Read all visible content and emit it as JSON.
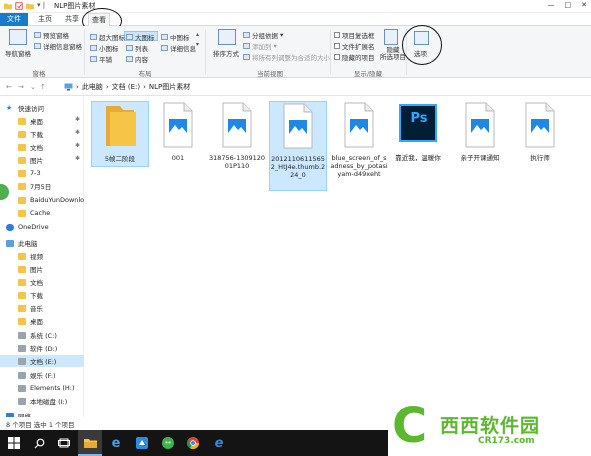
{
  "window": {
    "title": "NLP图片素材",
    "controls": [
      "—",
      "□",
      "✕"
    ]
  },
  "tabs": [
    {
      "label": "文件"
    },
    {
      "label": "主页"
    },
    {
      "label": "共享"
    },
    {
      "label": "查看"
    }
  ],
  "ribbon": {
    "panes": {
      "label": "窗格",
      "nav_pane": "导航窗格",
      "preview_pane": "预览窗格",
      "details_pane": "详细信息窗格"
    },
    "layout": {
      "label": "布局",
      "xl_icons": "超大图标",
      "large_icons": "大图标",
      "medium_icons": "中图标",
      "small_icons": "小图标",
      "list": "列表",
      "details": "详细信息",
      "tiles": "平铺",
      "content": "内容"
    },
    "current_view": {
      "label": "当前视图",
      "sort_by": "排序方式",
      "group_by": "分组依据",
      "add_columns": "添加列",
      "size_all_columns": "将所有列调整为合适的大小"
    },
    "show_hide": {
      "label": "显示/隐藏",
      "item_checkboxes": "项目复选框",
      "file_extensions": "文件扩展名",
      "hidden_items": "隐藏的项目",
      "hide_selected": "隐藏\n所选项目"
    },
    "options": "选项"
  },
  "address": {
    "crumbs": [
      "此电脑",
      "文档 (E:)",
      "NLP图片素材"
    ]
  },
  "nav_pane": {
    "items": [
      {
        "label": "快速访问",
        "icon": "star-icon",
        "indent": 0,
        "pinned": false
      },
      {
        "label": "桌面",
        "icon": "desktop-folder-icon",
        "indent": 1,
        "pinned": true
      },
      {
        "label": "下载",
        "icon": "download-folder-icon",
        "indent": 1,
        "pinned": true
      },
      {
        "label": "文档",
        "icon": "documents-folder-icon",
        "indent": 1,
        "pinned": true
      },
      {
        "label": "图片",
        "icon": "pictures-folder-icon",
        "indent": 1,
        "pinned": true
      },
      {
        "label": "7-3",
        "icon": "folder-icon",
        "indent": 1,
        "pinned": false
      },
      {
        "label": "7月5日",
        "icon": "folder-icon",
        "indent": 1,
        "pinned": false
      },
      {
        "label": "BaiduYunDownloa",
        "icon": "folder-icon",
        "indent": 1,
        "pinned": false
      },
      {
        "label": "Cache",
        "icon": "folder-icon",
        "indent": 1,
        "pinned": false
      },
      {
        "label": "OneDrive",
        "icon": "cloud-icon",
        "indent": 0,
        "pinned": false
      },
      {
        "label": "此电脑",
        "icon": "computer-icon",
        "indent": 0,
        "pinned": false
      },
      {
        "label": "视频",
        "icon": "video-folder-icon",
        "indent": 1,
        "pinned": false
      },
      {
        "label": "图片",
        "icon": "pictures-folder-icon",
        "indent": 1,
        "pinned": false
      },
      {
        "label": "文档",
        "icon": "documents-folder-icon",
        "indent": 1,
        "pinned": false
      },
      {
        "label": "下载",
        "icon": "download-folder-icon",
        "indent": 1,
        "pinned": false
      },
      {
        "label": "音乐",
        "icon": "music-folder-icon",
        "indent": 1,
        "pinned": false
      },
      {
        "label": "桌面",
        "icon": "desktop-folder-icon",
        "indent": 1,
        "pinned": false
      },
      {
        "label": "系统 (C:)",
        "icon": "drive-icon",
        "indent": 1,
        "pinned": false
      },
      {
        "label": "软件 (D:)",
        "icon": "drive-icon",
        "indent": 1,
        "pinned": false
      },
      {
        "label": "文档 (E:)",
        "icon": "drive-icon",
        "indent": 1,
        "pinned": false,
        "selected": true
      },
      {
        "label": "娱乐 (F:)",
        "icon": "drive-icon",
        "indent": 1,
        "pinned": false
      },
      {
        "label": "Elements (H:)",
        "icon": "drive-icon",
        "indent": 1,
        "pinned": false
      },
      {
        "label": "本地磁盘 (I:)",
        "icon": "drive-icon",
        "indent": 1,
        "pinned": false
      },
      {
        "label": "网络",
        "icon": "network-icon",
        "indent": 0,
        "pinned": false
      }
    ]
  },
  "files": [
    {
      "name": "5帧二阶段",
      "type": "folder",
      "selected": true
    },
    {
      "name": "001",
      "type": "image"
    },
    {
      "name": "318756-130912001P110",
      "type": "image"
    },
    {
      "name": "20121106115652_HtJ4e.thumb.224_0",
      "type": "image",
      "selected": true
    },
    {
      "name": "blue_screen_of_sadness_by_potasiyam-d49xeht",
      "type": "document"
    },
    {
      "name": "靠近我，温暖你",
      "type": "photoshop",
      "ps_label": "Ps"
    },
    {
      "name": "亲子开课通知",
      "type": "image"
    },
    {
      "name": "执行师",
      "type": "image"
    }
  ],
  "status": {
    "text": "8 个项目    选中 1 个项目"
  },
  "watermark": {
    "letter": "C",
    "title": "西西软件园",
    "url": "CR173.com"
  },
  "colors": {
    "accent": "#1979ca",
    "selection": "#cce8ff",
    "folder": "#f6c548",
    "image_blue": "#1e88e5",
    "ps_blue": "#31a8ff",
    "ps_bg": "#001e36",
    "taskbar": "#141414",
    "watermark_green": "#5cb82e"
  }
}
